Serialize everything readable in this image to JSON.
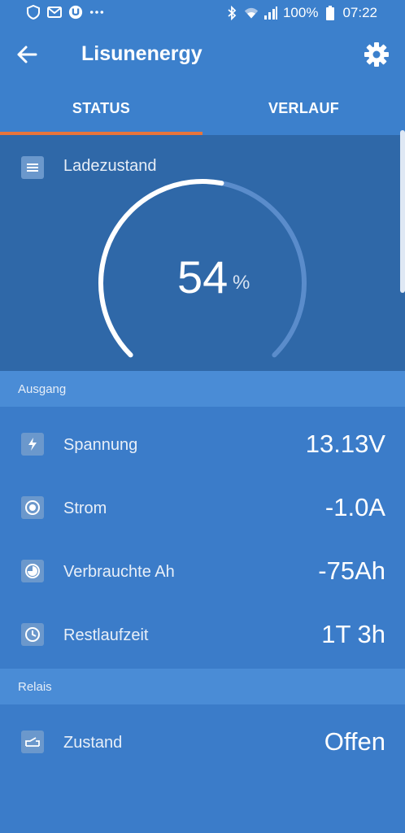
{
  "status_bar": {
    "battery_percent": "100%",
    "time": "07:22",
    "left_icons": [
      "shield-icon",
      "mail-icon",
      "u-app-icon",
      "more-icon"
    ],
    "right_icons": [
      "bluetooth-icon",
      "wifi-icon",
      "signal-icon",
      "battery-icon"
    ]
  },
  "app_bar": {
    "title": "Lisunenergy"
  },
  "tabs": [
    {
      "label": "STATUS",
      "selected": true
    },
    {
      "label": "VERLAUF",
      "selected": false
    }
  ],
  "soc": {
    "label": "Ladezustand",
    "value": "54",
    "unit": "%",
    "level": 0.54
  },
  "sections": {
    "output": {
      "title": "Ausgang",
      "rows": [
        {
          "label": "Spannung",
          "value": "13.13V",
          "icon": "lightning-icon"
        },
        {
          "label": "Strom",
          "value": "-1.0A",
          "icon": "current-icon"
        },
        {
          "label": "Verbrauchte Ah",
          "value": "-75Ah",
          "icon": "consumed-icon"
        },
        {
          "label": "Restlaufzeit",
          "value": "1T 3h",
          "icon": "clock-icon"
        }
      ]
    },
    "relay": {
      "title": "Relais",
      "rows": [
        {
          "label": "Zustand",
          "value": "Offen",
          "icon": "relay-icon"
        }
      ]
    }
  },
  "colors": {
    "accent": "#e8743a",
    "primary": "#3c80cc",
    "card": "#2f68a8"
  }
}
